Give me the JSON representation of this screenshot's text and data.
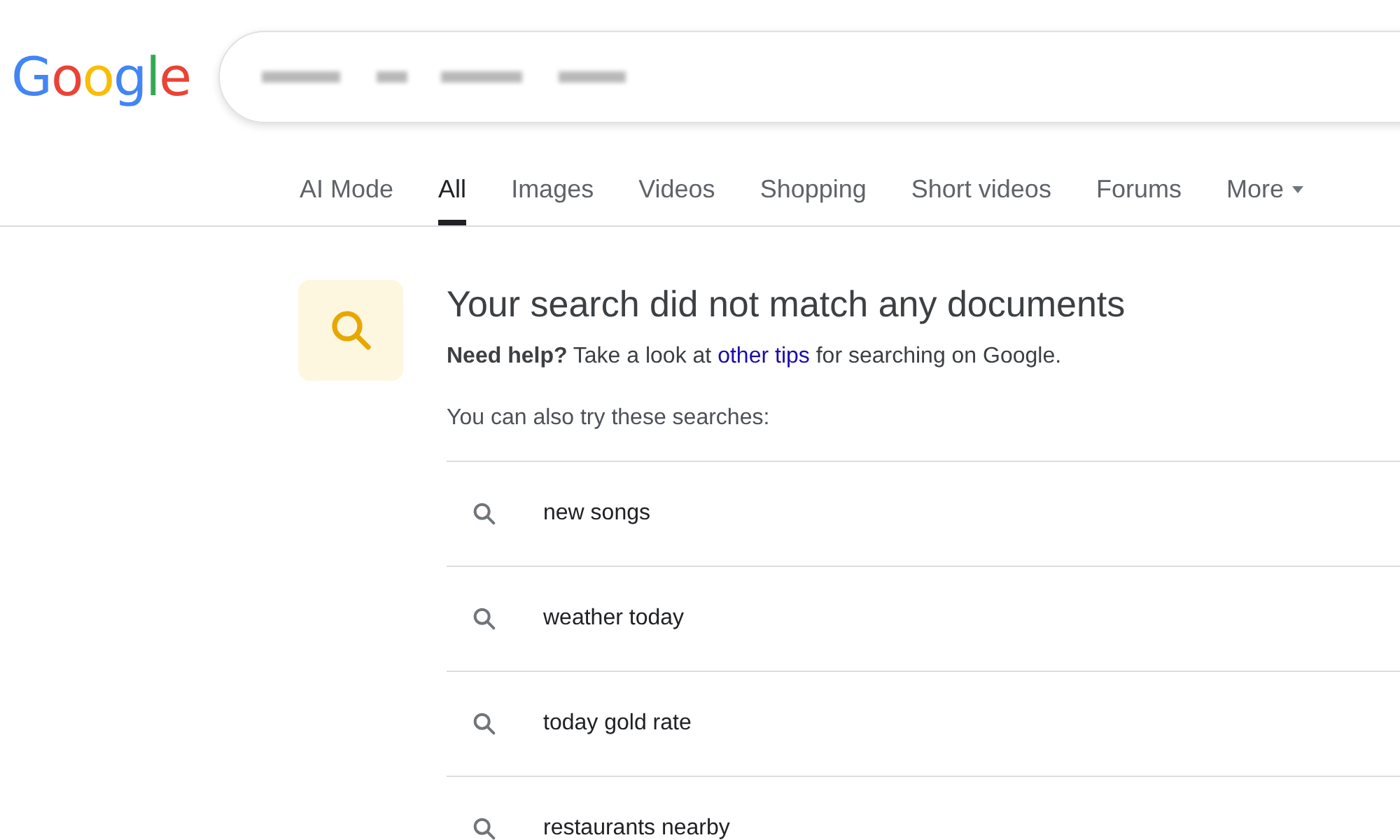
{
  "logo": "Google",
  "tabs": [
    {
      "label": "AI Mode",
      "selected": false
    },
    {
      "label": "All",
      "selected": true
    },
    {
      "label": "Images",
      "selected": false
    },
    {
      "label": "Videos",
      "selected": false
    },
    {
      "label": "Shopping",
      "selected": false
    },
    {
      "label": "Short videos",
      "selected": false
    },
    {
      "label": "Forums",
      "selected": false
    },
    {
      "label": "More",
      "selected": false,
      "kind": "menu"
    }
  ],
  "message": {
    "title": "Your search did not match any documents",
    "help_before": "**Need help?** Take a look at",
    "help_link": "other tips",
    "help_after": "for searching on Google.",
    "suggestions_label": "You can also try these searches:"
  },
  "suggestions": [
    "new songs",
    "weather today",
    "today gold rate",
    "restaurants nearby"
  ]
}
